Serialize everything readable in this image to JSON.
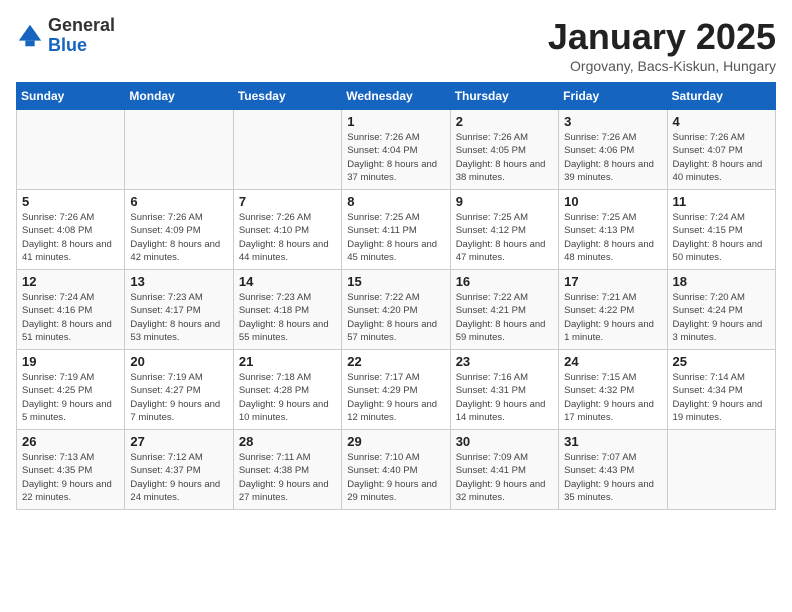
{
  "header": {
    "logo_general": "General",
    "logo_blue": "Blue",
    "month_year": "January 2025",
    "location": "Orgovany, Bacs-Kiskun, Hungary"
  },
  "days_of_week": [
    "Sunday",
    "Monday",
    "Tuesday",
    "Wednesday",
    "Thursday",
    "Friday",
    "Saturday"
  ],
  "weeks": [
    [
      {
        "day": "",
        "info": ""
      },
      {
        "day": "",
        "info": ""
      },
      {
        "day": "",
        "info": ""
      },
      {
        "day": "1",
        "info": "Sunrise: 7:26 AM\nSunset: 4:04 PM\nDaylight: 8 hours and 37 minutes."
      },
      {
        "day": "2",
        "info": "Sunrise: 7:26 AM\nSunset: 4:05 PM\nDaylight: 8 hours and 38 minutes."
      },
      {
        "day": "3",
        "info": "Sunrise: 7:26 AM\nSunset: 4:06 PM\nDaylight: 8 hours and 39 minutes."
      },
      {
        "day": "4",
        "info": "Sunrise: 7:26 AM\nSunset: 4:07 PM\nDaylight: 8 hours and 40 minutes."
      }
    ],
    [
      {
        "day": "5",
        "info": "Sunrise: 7:26 AM\nSunset: 4:08 PM\nDaylight: 8 hours and 41 minutes."
      },
      {
        "day": "6",
        "info": "Sunrise: 7:26 AM\nSunset: 4:09 PM\nDaylight: 8 hours and 42 minutes."
      },
      {
        "day": "7",
        "info": "Sunrise: 7:26 AM\nSunset: 4:10 PM\nDaylight: 8 hours and 44 minutes."
      },
      {
        "day": "8",
        "info": "Sunrise: 7:25 AM\nSunset: 4:11 PM\nDaylight: 8 hours and 45 minutes."
      },
      {
        "day": "9",
        "info": "Sunrise: 7:25 AM\nSunset: 4:12 PM\nDaylight: 8 hours and 47 minutes."
      },
      {
        "day": "10",
        "info": "Sunrise: 7:25 AM\nSunset: 4:13 PM\nDaylight: 8 hours and 48 minutes."
      },
      {
        "day": "11",
        "info": "Sunrise: 7:24 AM\nSunset: 4:15 PM\nDaylight: 8 hours and 50 minutes."
      }
    ],
    [
      {
        "day": "12",
        "info": "Sunrise: 7:24 AM\nSunset: 4:16 PM\nDaylight: 8 hours and 51 minutes."
      },
      {
        "day": "13",
        "info": "Sunrise: 7:23 AM\nSunset: 4:17 PM\nDaylight: 8 hours and 53 minutes."
      },
      {
        "day": "14",
        "info": "Sunrise: 7:23 AM\nSunset: 4:18 PM\nDaylight: 8 hours and 55 minutes."
      },
      {
        "day": "15",
        "info": "Sunrise: 7:22 AM\nSunset: 4:20 PM\nDaylight: 8 hours and 57 minutes."
      },
      {
        "day": "16",
        "info": "Sunrise: 7:22 AM\nSunset: 4:21 PM\nDaylight: 8 hours and 59 minutes."
      },
      {
        "day": "17",
        "info": "Sunrise: 7:21 AM\nSunset: 4:22 PM\nDaylight: 9 hours and 1 minute."
      },
      {
        "day": "18",
        "info": "Sunrise: 7:20 AM\nSunset: 4:24 PM\nDaylight: 9 hours and 3 minutes."
      }
    ],
    [
      {
        "day": "19",
        "info": "Sunrise: 7:19 AM\nSunset: 4:25 PM\nDaylight: 9 hours and 5 minutes."
      },
      {
        "day": "20",
        "info": "Sunrise: 7:19 AM\nSunset: 4:27 PM\nDaylight: 9 hours and 7 minutes."
      },
      {
        "day": "21",
        "info": "Sunrise: 7:18 AM\nSunset: 4:28 PM\nDaylight: 9 hours and 10 minutes."
      },
      {
        "day": "22",
        "info": "Sunrise: 7:17 AM\nSunset: 4:29 PM\nDaylight: 9 hours and 12 minutes."
      },
      {
        "day": "23",
        "info": "Sunrise: 7:16 AM\nSunset: 4:31 PM\nDaylight: 9 hours and 14 minutes."
      },
      {
        "day": "24",
        "info": "Sunrise: 7:15 AM\nSunset: 4:32 PM\nDaylight: 9 hours and 17 minutes."
      },
      {
        "day": "25",
        "info": "Sunrise: 7:14 AM\nSunset: 4:34 PM\nDaylight: 9 hours and 19 minutes."
      }
    ],
    [
      {
        "day": "26",
        "info": "Sunrise: 7:13 AM\nSunset: 4:35 PM\nDaylight: 9 hours and 22 minutes."
      },
      {
        "day": "27",
        "info": "Sunrise: 7:12 AM\nSunset: 4:37 PM\nDaylight: 9 hours and 24 minutes."
      },
      {
        "day": "28",
        "info": "Sunrise: 7:11 AM\nSunset: 4:38 PM\nDaylight: 9 hours and 27 minutes."
      },
      {
        "day": "29",
        "info": "Sunrise: 7:10 AM\nSunset: 4:40 PM\nDaylight: 9 hours and 29 minutes."
      },
      {
        "day": "30",
        "info": "Sunrise: 7:09 AM\nSunset: 4:41 PM\nDaylight: 9 hours and 32 minutes."
      },
      {
        "day": "31",
        "info": "Sunrise: 7:07 AM\nSunset: 4:43 PM\nDaylight: 9 hours and 35 minutes."
      },
      {
        "day": "",
        "info": ""
      }
    ]
  ]
}
